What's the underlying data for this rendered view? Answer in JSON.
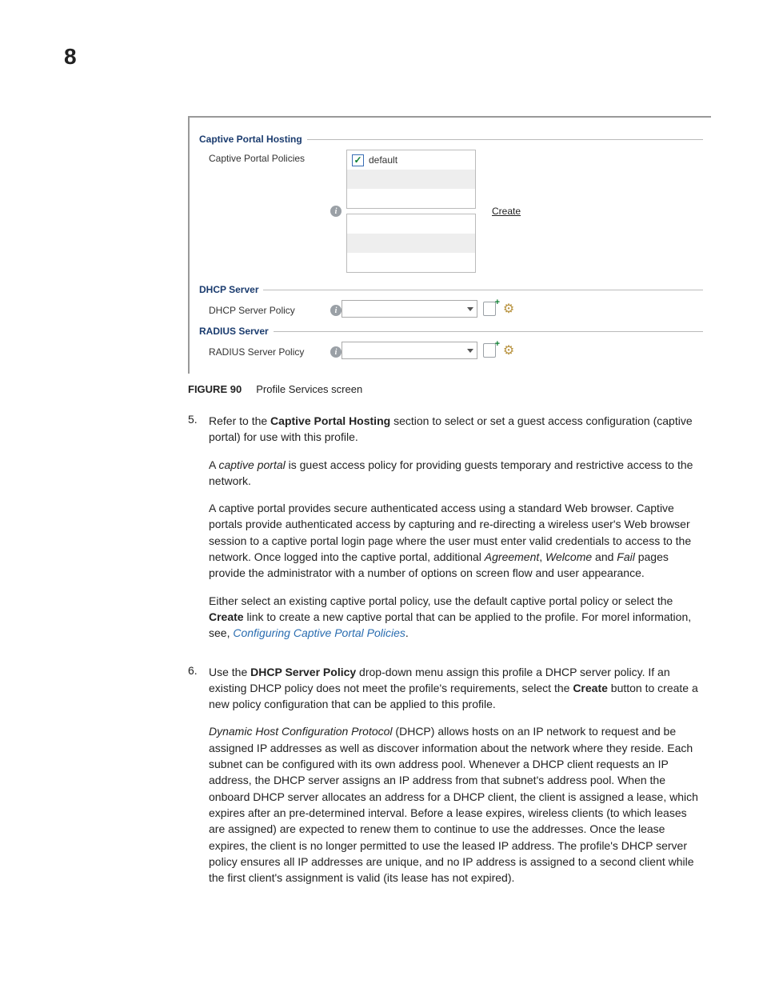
{
  "page_number": "8",
  "figure": {
    "groups": {
      "captive": {
        "title": "Captive Portal Hosting",
        "policies_label": "Captive Portal Policies",
        "default_item": "default",
        "create_link": "Create"
      },
      "dhcp": {
        "title": "DHCP Server",
        "policy_label": "DHCP Server Policy"
      },
      "radius": {
        "title": "RADIUS Server",
        "policy_label": "RADIUS Server Policy"
      }
    },
    "caption_label": "FIGURE 90",
    "caption_text": "Profile Services screen"
  },
  "steps": {
    "s5": {
      "num": "5.",
      "p1_a": "Refer to the ",
      "p1_b": "Captive Portal Hosting",
      "p1_c": " section to select or set a guest access configuration (captive portal) for use with this profile.",
      "p2_a": "A ",
      "p2_b": "captive portal",
      "p2_c": " is guest access policy for providing guests temporary and restrictive access to the network.",
      "p3_a": "A captive portal provides secure authenticated access using a standard Web browser. Captive portals provide authenticated access by capturing and re-directing a wireless user's Web browser session to a captive portal login page where the user must enter valid credentials to access to the network. Once logged into the captive portal, additional ",
      "p3_b": "Agreement",
      "p3_c": ", ",
      "p3_d": "Welcome",
      "p3_e": " and ",
      "p3_f": "Fail",
      "p3_g": " pages provide the administrator with a number of options on screen flow and user appearance.",
      "p4_a": "Either select an existing captive portal policy, use the default captive portal policy or select the ",
      "p4_b": "Create",
      "p4_c": " link to create a new captive portal that can be applied to the profile. For morel information, see, ",
      "p4_link": "Configuring Captive Portal Policies",
      "p4_d": "."
    },
    "s6": {
      "num": "6.",
      "p1_a": "Use the ",
      "p1_b": "DHCP Server Policy",
      "p1_c": " drop-down menu assign this profile a DHCP server policy. If an existing DHCP policy does not meet the profile's requirements, select the ",
      "p1_d": "Create",
      "p1_e": " button to create a new policy configuration that can be applied to this profile.",
      "p2_a": "Dynamic Host Configuration Protocol",
      "p2_b": " (DHCP) allows hosts on an IP network to request and be assigned IP addresses as well as discover information about the network where they reside. Each subnet can be configured with its own address pool. Whenever a DHCP client requests an IP address, the DHCP server assigns an IP address from that subnet's address pool. When the onboard DHCP server allocates an address for a DHCP client, the client is assigned a lease, which expires after an pre-determined interval. Before a lease expires, wireless clients (to which leases are assigned) are expected to renew them to continue to use the addresses. Once the lease expires, the client is no longer permitted to use the leased IP address. The profile's DHCP server policy ensures all IP addresses are unique, and no IP address is assigned to a second client while the first client's assignment is valid (its lease has not expired)."
    }
  }
}
